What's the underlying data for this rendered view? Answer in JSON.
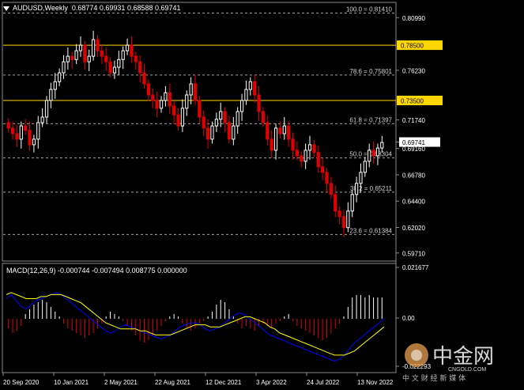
{
  "header": {
    "symbol_title": "AUDUSD,Weekly",
    "ohlc": "0.68774 0.69931 0.68588 0.69741"
  },
  "macd": {
    "title": "MACD(12,26,9) -0.000744 -0.007494 0.008775 0.000000",
    "axis_labels": [
      "0.021677",
      "0.00",
      "-0.022293"
    ]
  },
  "price_axis": {
    "labels": [
      "0.80990",
      "0.78500",
      "0.76230",
      "0.73500",
      "0.71740",
      "0.69741",
      "0.69160",
      "0.66780",
      "0.64400",
      "0.62020",
      "0.59710"
    ],
    "current_price": "0.69741"
  },
  "fib_levels": [
    {
      "label": "100.0 = 0.81410",
      "value": 0.8141
    },
    {
      "label": "78.6 = 0.75801",
      "value": 0.75801
    },
    {
      "label": "61.8 = 0.71397",
      "value": 0.71397
    },
    {
      "label": "50.0 = 0.68304",
      "value": 0.68304
    },
    {
      "label": "38.2 = 0.65211",
      "value": 0.65211
    },
    {
      "label": "23.6 = 0.61384",
      "value": 0.61384
    }
  ],
  "horizontal_lines": [
    {
      "label": "0.78500",
      "value": 0.785,
      "color": "#ffd700"
    },
    {
      "label": "0.73500",
      "value": 0.735,
      "color": "#ffd700"
    }
  ],
  "time_axis": [
    "20 Sep 2020",
    "10 Jan 2021",
    "2 May 2021",
    "22 Aug 2021",
    "12 Dec 2021",
    "3 Apr 2022",
    "24 Jul 2022",
    "13 Nov 2022"
  ],
  "watermark": {
    "brand": "中金网",
    "domain": "CNGOLD.COM",
    "slogan": "中 文 财 经 新 媒 体"
  },
  "colors": {
    "bull": "#ffffff",
    "bear": "#e00000",
    "signal": "#ffff00",
    "macd_line": "#0000ff",
    "fib": "#a0a0a0",
    "level": "#ffd700"
  },
  "chart_data": {
    "type": "candlestick",
    "price_range": [
      0.5971,
      0.8141
    ],
    "closes": [
      0.71,
      0.705,
      0.7,
      0.712,
      0.708,
      0.695,
      0.7,
      0.715,
      0.72,
      0.735,
      0.745,
      0.752,
      0.76,
      0.77,
      0.775,
      0.772,
      0.78,
      0.785,
      0.77,
      0.775,
      0.79,
      0.78,
      0.775,
      0.77,
      0.76,
      0.765,
      0.772,
      0.78,
      0.785,
      0.775,
      0.77,
      0.76,
      0.75,
      0.74,
      0.735,
      0.728,
      0.735,
      0.742,
      0.73,
      0.722,
      0.712,
      0.728,
      0.74,
      0.75,
      0.735,
      0.72,
      0.71,
      0.7,
      0.712,
      0.718,
      0.725,
      0.715,
      0.7,
      0.712,
      0.725,
      0.735,
      0.745,
      0.752,
      0.74,
      0.725,
      0.715,
      0.7,
      0.69,
      0.71,
      0.705,
      0.712,
      0.7,
      0.69,
      0.685,
      0.68,
      0.69,
      0.695,
      0.688,
      0.675,
      0.67,
      0.66,
      0.65,
      0.635,
      0.63,
      0.62,
      0.635,
      0.65,
      0.66,
      0.67,
      0.68,
      0.69,
      0.685,
      0.692,
      0.697
    ]
  }
}
